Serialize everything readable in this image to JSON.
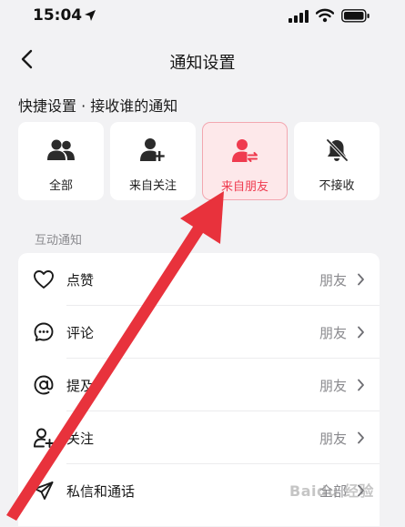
{
  "status_bar": {
    "time": "15:04",
    "icons": [
      "location-arrow-icon",
      "signal-icon",
      "wifi-icon",
      "battery-icon"
    ]
  },
  "nav": {
    "title": "通知设置",
    "back_icon": "chevron-left-icon"
  },
  "quick_settings": {
    "heading": "快捷设置 · 接收谁的通知",
    "options": [
      {
        "label": "全部",
        "icon": "people-icon",
        "selected": false
      },
      {
        "label": "来自关注",
        "icon": "person-add-icon",
        "selected": false
      },
      {
        "label": "来自朋友",
        "icon": "person-exchange-icon",
        "selected": true
      },
      {
        "label": "不接收",
        "icon": "bell-off-icon",
        "selected": false
      }
    ]
  },
  "interaction": {
    "heading": "互动通知",
    "rows": [
      {
        "label": "点赞",
        "value": "朋友",
        "icon": "heart-icon"
      },
      {
        "label": "评论",
        "value": "朋友",
        "icon": "comment-icon"
      },
      {
        "label": "提及",
        "value": "朋友",
        "icon": "at-icon"
      },
      {
        "label": "关注",
        "value": "朋友",
        "icon": "person-add-icon"
      },
      {
        "label": "私信和通话",
        "value": "全部",
        "icon": "send-icon"
      }
    ]
  },
  "colors": {
    "accent": "#ef3b4f",
    "selected_bg": "#fde8ea",
    "annotation_arrow": "#e8323c"
  },
  "watermark": "Baidu 经验"
}
